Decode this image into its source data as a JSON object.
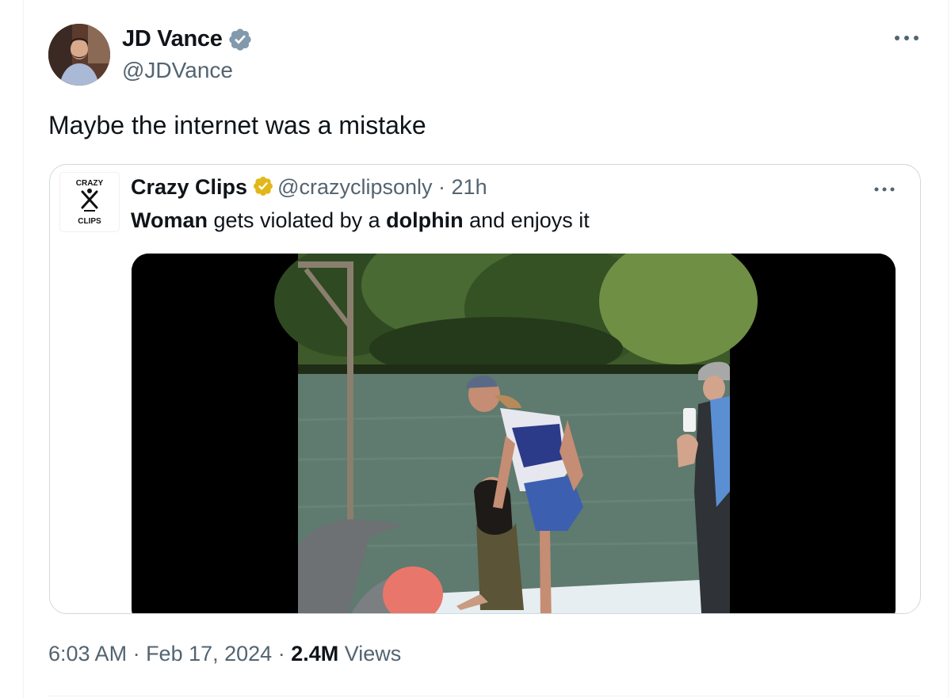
{
  "tweet": {
    "author_name": "JD Vance",
    "author_handle": "@JDVance",
    "text": "Maybe the internet was a mistake",
    "time": "6:03 AM",
    "date": "Feb 17, 2024",
    "views_count": "2.4M",
    "views_label": "Views",
    "separator": " · "
  },
  "quoted": {
    "author_name": "Crazy Clips",
    "author_handle": "@crazyclipsonly",
    "age": "21h",
    "text_parts": [
      "Woman",
      " gets violated by a ",
      "dolphin",
      " and enjoys it"
    ],
    "logo_top": "CRAZY",
    "logo_bottom": "CLIPS"
  },
  "icons": {
    "author_verified": "verified-badge-icon",
    "quoted_verified": "gold-verified-badge-icon",
    "more": "more-options-icon"
  },
  "colors": {
    "verified_blue": "#829aab",
    "verified_gold": "#e2b719",
    "secondary_text": "#536471",
    "border": "#cfd9de"
  }
}
